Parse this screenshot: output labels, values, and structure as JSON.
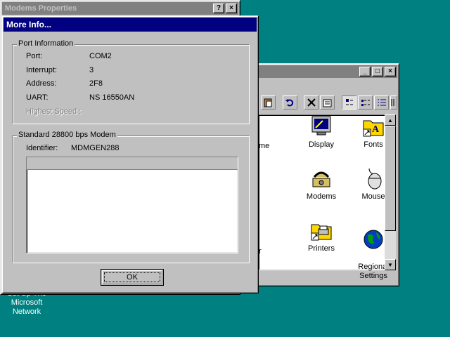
{
  "desktop": {
    "icon_label": "Set Up The\nMicrosoft\nNetwork"
  },
  "control_panel": {
    "window_buttons": {
      "minimize": "_",
      "maximize": "□",
      "close": "×"
    },
    "items": [
      {
        "label": "me",
        "icon": "partial-icon"
      },
      {
        "label": "Display",
        "icon": "display-icon"
      },
      {
        "label": "Fonts",
        "icon": "fonts-folder-icon"
      },
      {
        "label": "Modems",
        "icon": "modem-phone-icon"
      },
      {
        "label": "Mouse",
        "icon": "mouse-icon"
      },
      {
        "label": "r",
        "icon": "partial-icon"
      },
      {
        "label": "Printers",
        "icon": "printers-folder-icon"
      },
      {
        "label": "Regional\nSettings",
        "icon": "globe-icon"
      }
    ]
  },
  "modems_properties": {
    "title": "Modems Properties",
    "help_button": "?",
    "close_button": "×"
  },
  "more_info": {
    "title": "More Info...",
    "port_group": {
      "title": "Port Information",
      "rows": [
        {
          "label": "Port:",
          "value": "COM2"
        },
        {
          "label": "Interrupt:",
          "value": "3"
        },
        {
          "label": "Address:",
          "value": "2F8"
        },
        {
          "label": "UART:",
          "value": "NS 16550AN"
        }
      ],
      "highest_speed_label": "Highest Speed :"
    },
    "modem_group": {
      "title": "Standard 28800 bps Modem",
      "identifier_label": "Identifier:",
      "identifier_value": "MDMGEN288"
    },
    "ok_label": "OK"
  }
}
